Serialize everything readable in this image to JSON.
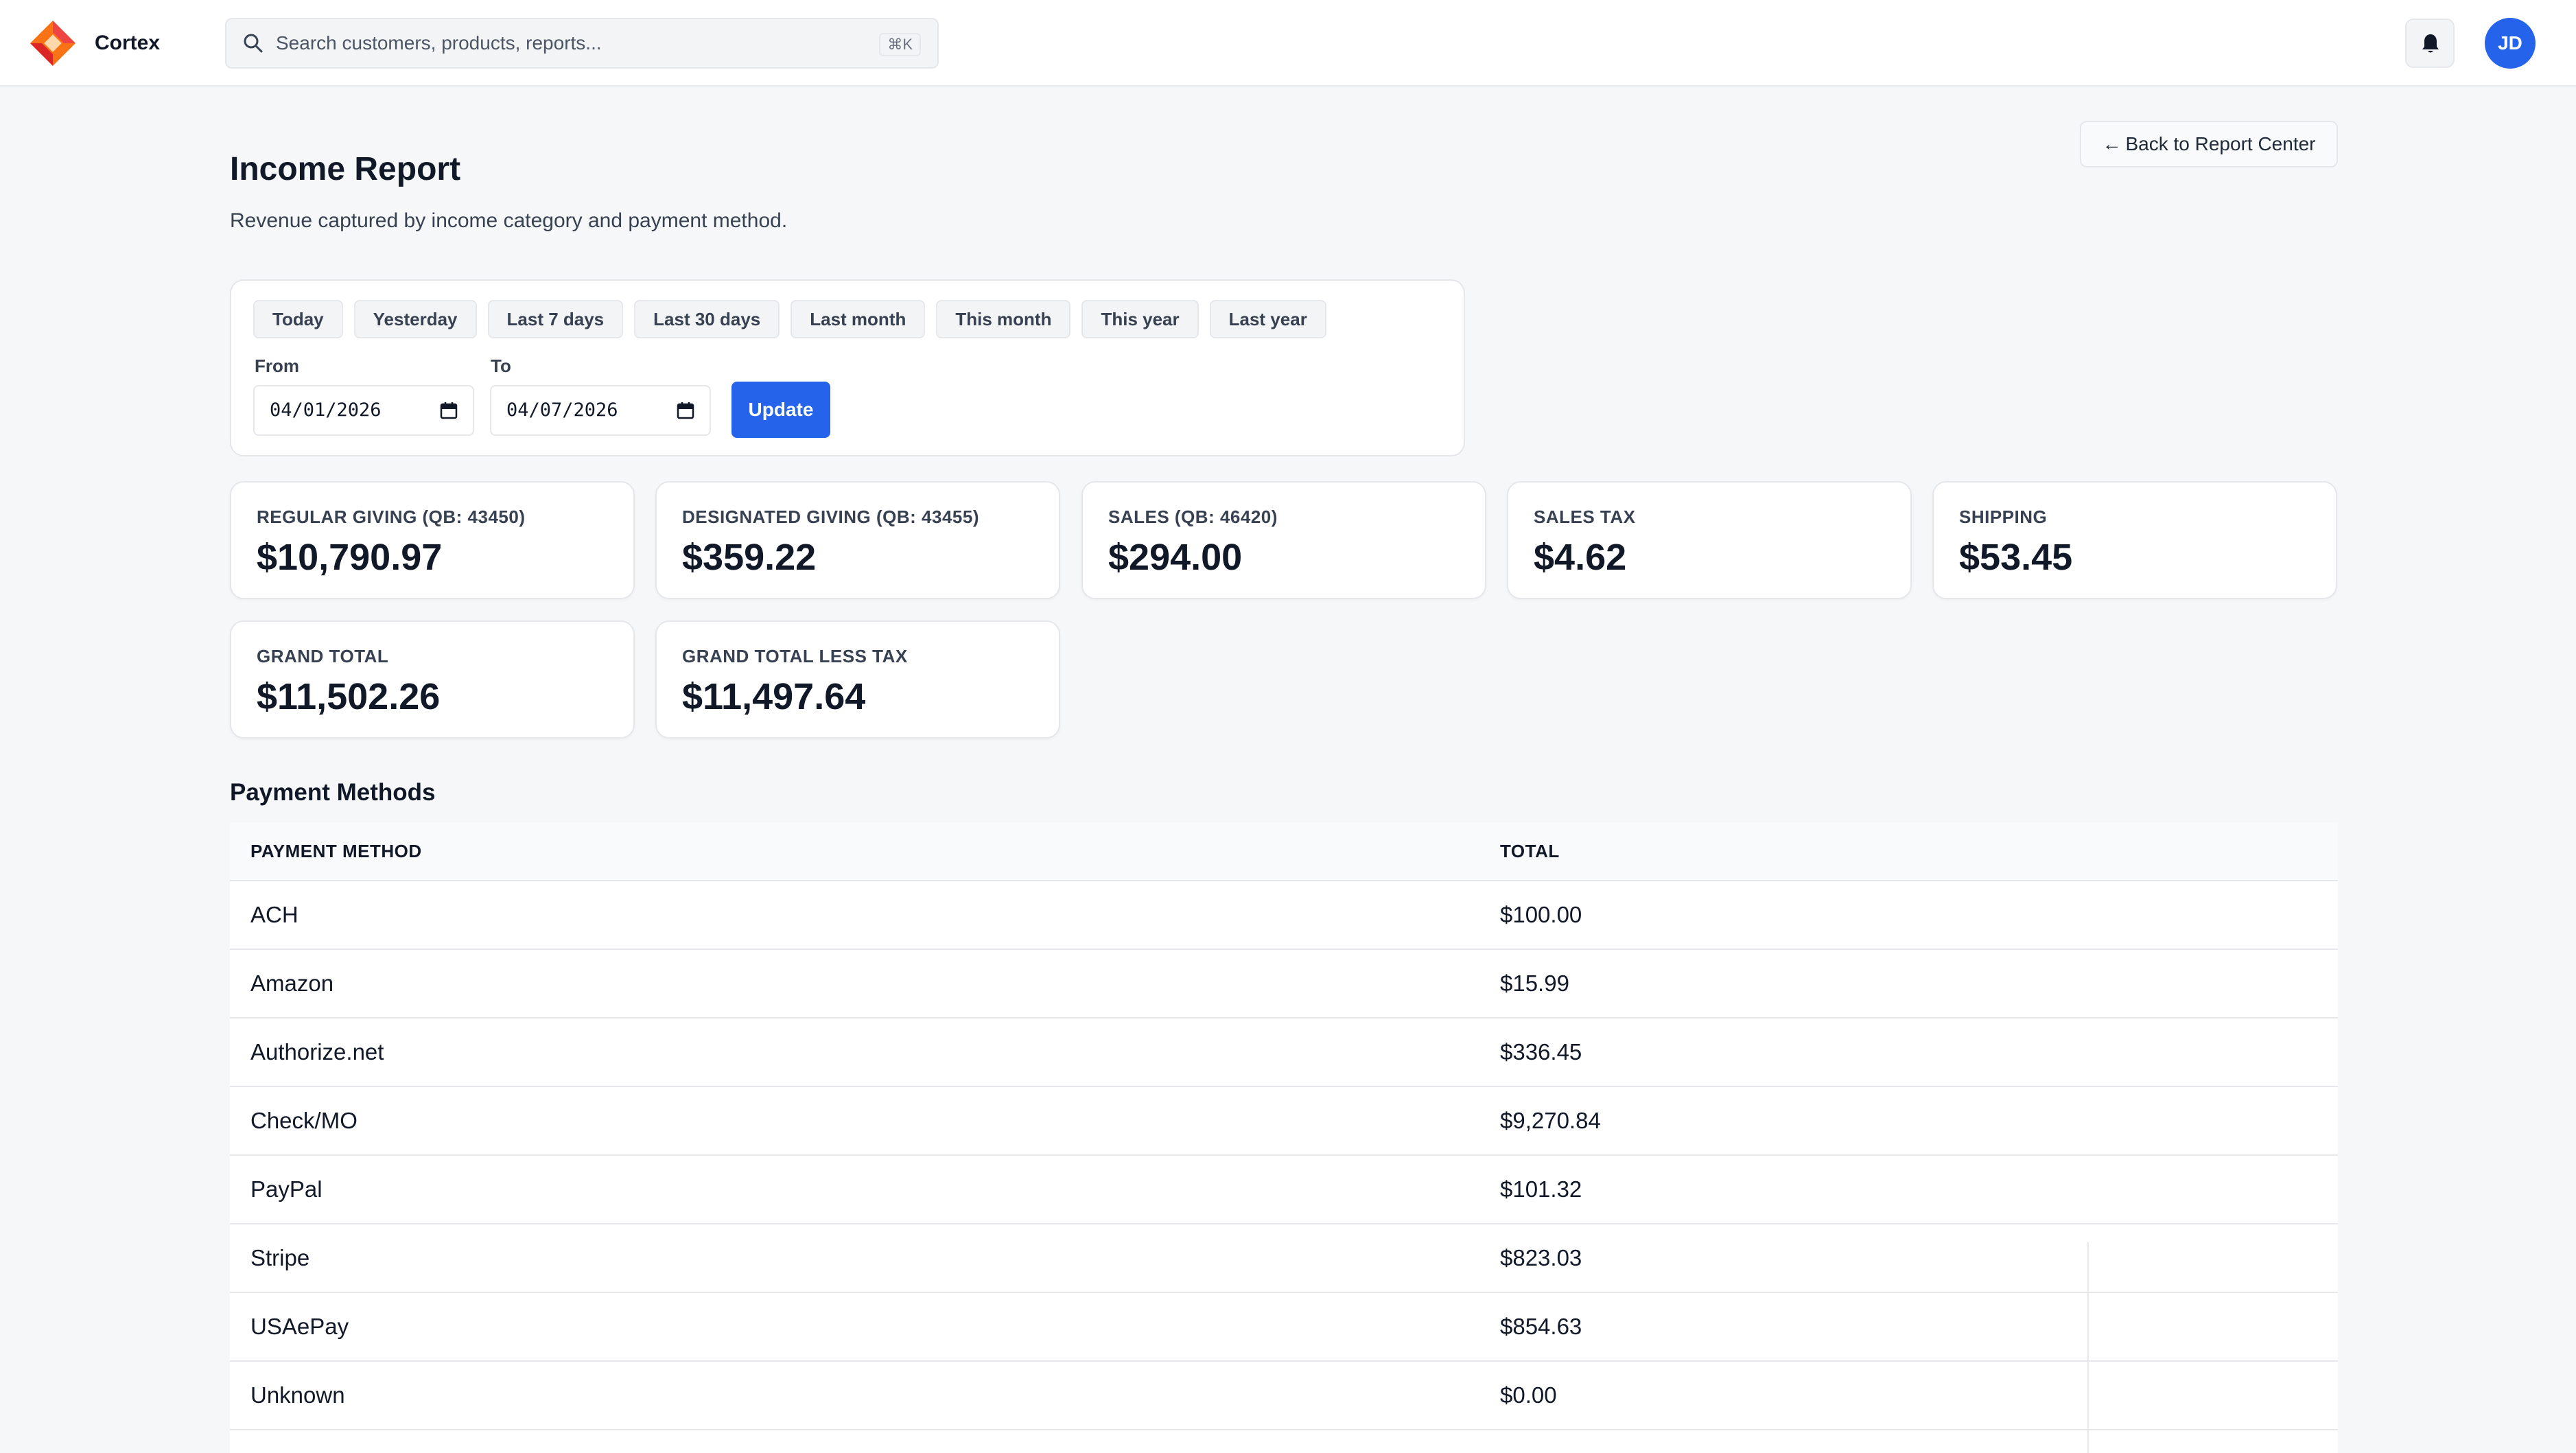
{
  "app": {
    "brand": "Cortex",
    "search_placeholder": "Search customers, products, reports...",
    "search_shortcut": "⌘K",
    "avatar_initials": "JD",
    "accent_color": "#2563eb"
  },
  "header": {
    "title": "Income Report",
    "subtitle": "Revenue captured by income category and payment method.",
    "back_label": "Back to Report Center"
  },
  "filters": {
    "presets": [
      "Today",
      "Yesterday",
      "Last 7 days",
      "Last 30 days",
      "Last month",
      "This month",
      "This year",
      "Last year"
    ],
    "from_label": "From",
    "from_value": "04/01/2026",
    "to_label": "To",
    "to_value": "04/07/2026",
    "update_label": "Update"
  },
  "stats": [
    {
      "label": "REGULAR GIVING (QB: 43450)",
      "value": "$10,790.97"
    },
    {
      "label": "DESIGNATED GIVING (QB: 43455)",
      "value": "$359.22"
    },
    {
      "label": "SALES (QB: 46420)",
      "value": "$294.00"
    },
    {
      "label": "SALES TAX",
      "value": "$4.62"
    },
    {
      "label": "SHIPPING",
      "value": "$53.45"
    },
    {
      "label": "GRAND TOTAL",
      "value": "$11,502.26"
    },
    {
      "label": "GRAND TOTAL LESS TAX",
      "value": "$11,497.64"
    }
  ],
  "payment_methods": {
    "title": "Payment Methods",
    "columns": [
      "PAYMENT METHOD",
      "TOTAL"
    ],
    "rows": [
      {
        "method": "ACH",
        "total": "$100.00"
      },
      {
        "method": "Amazon",
        "total": "$15.99"
      },
      {
        "method": "Authorize.net",
        "total": "$336.45"
      },
      {
        "method": "Check/MO",
        "total": "$9,270.84"
      },
      {
        "method": "PayPal",
        "total": "$101.32"
      },
      {
        "method": "Stripe",
        "total": "$823.03"
      },
      {
        "method": "USAePay",
        "total": "$854.63"
      },
      {
        "method": "Unknown",
        "total": "$0.00"
      }
    ]
  }
}
